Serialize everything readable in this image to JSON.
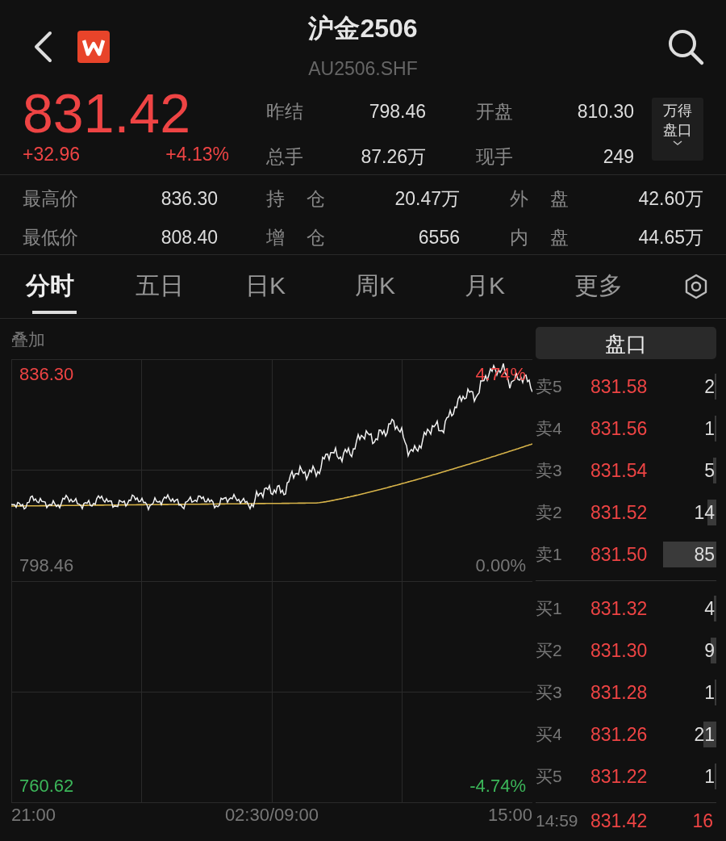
{
  "header": {
    "title": "沪金2506",
    "code": "AU2506.SHF"
  },
  "quote": {
    "price": "831.42",
    "change": "+32.96",
    "change_pct": "+4.13%",
    "fields": [
      {
        "label": "昨结",
        "value": "798.46"
      },
      {
        "label": "开盘",
        "value": "810.30"
      },
      {
        "label": "总手",
        "value": "87.26万"
      },
      {
        "label": "现手",
        "value": "249"
      }
    ],
    "panel_button": "万得盘口"
  },
  "stats": [
    [
      {
        "label": "最高价",
        "value": "836.30"
      },
      {
        "label": "持 仓",
        "value": "20.47万"
      },
      {
        "label": "外 盘",
        "value": "42.60万"
      }
    ],
    [
      {
        "label": "最低价",
        "value": "808.40"
      },
      {
        "label": "增 仓",
        "value": "6556"
      },
      {
        "label": "内 盘",
        "value": "44.65万"
      }
    ]
  ],
  "tabs": [
    {
      "label": "分时",
      "selected": true
    },
    {
      "label": "五日",
      "selected": false
    },
    {
      "label": "日K",
      "selected": false
    },
    {
      "label": "周K",
      "selected": false
    },
    {
      "label": "月K",
      "selected": false
    },
    {
      "label": "更多",
      "selected": false
    }
  ],
  "chart": {
    "overlay_label": "叠加",
    "y_high": "836.30",
    "pct_high": "4.74%",
    "y_mid": "798.46",
    "pct_mid": "0.00%",
    "y_low": "760.62",
    "pct_low": "-4.74%",
    "times": [
      "21:00",
      "02:30/09:00",
      "15:00"
    ]
  },
  "orderbook": {
    "title": "盘口",
    "asks": [
      {
        "label": "卖5",
        "price": "831.58",
        "volume": "2"
      },
      {
        "label": "卖4",
        "price": "831.56",
        "volume": "1"
      },
      {
        "label": "卖3",
        "price": "831.54",
        "volume": "5"
      },
      {
        "label": "卖2",
        "price": "831.52",
        "volume": "14"
      },
      {
        "label": "卖1",
        "price": "831.50",
        "volume": "85"
      }
    ],
    "bids": [
      {
        "label": "买1",
        "price": "831.32",
        "volume": "4"
      },
      {
        "label": "买2",
        "price": "831.30",
        "volume": "9"
      },
      {
        "label": "买3",
        "price": "831.28",
        "volume": "1"
      },
      {
        "label": "买4",
        "price": "831.26",
        "volume": "21"
      },
      {
        "label": "买5",
        "price": "831.22",
        "volume": "1"
      }
    ],
    "last_trade": {
      "time": "14:59",
      "price": "831.42",
      "volume": "16"
    }
  }
}
